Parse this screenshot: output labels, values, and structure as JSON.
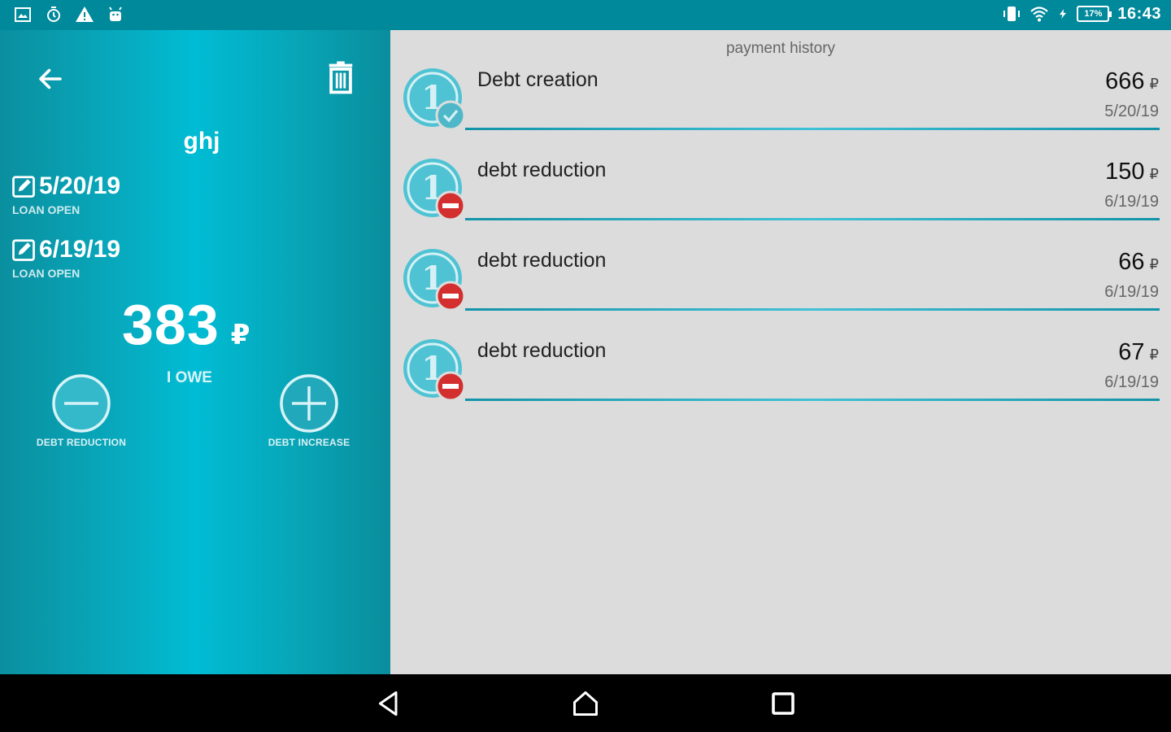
{
  "status_bar": {
    "left_icons": [
      "image-notification-icon",
      "alarm-notification-icon",
      "warning-icon",
      "android-icon"
    ],
    "right_icons": [
      "vibrate-icon",
      "wifi-icon",
      "charging-icon"
    ],
    "battery": "17%",
    "time": "16:43"
  },
  "detail": {
    "name": "ghj",
    "open_date": "5/20/19",
    "open_label": "LOAN OPEN",
    "close_date": "6/19/19",
    "close_label": "LOAN OPEN",
    "amount": "383",
    "currency": "₽",
    "direction_label": "I OWE",
    "reduce_label": "DEBT REDUCTION",
    "increase_label": "DEBT INCREASE"
  },
  "history": {
    "title": "payment history",
    "items": [
      {
        "title": "Debt creation",
        "amount": "666",
        "currency": "₽",
        "date": "5/20/19",
        "badge": "check-badge-icon"
      },
      {
        "title": "debt reduction",
        "amount": "150",
        "currency": "₽",
        "date": "6/19/19",
        "badge": "minus-badge-icon"
      },
      {
        "title": "debt reduction",
        "amount": "66",
        "currency": "₽",
        "date": "6/19/19",
        "badge": "minus-badge-icon"
      },
      {
        "title": "debt reduction",
        "amount": "67",
        "currency": "₽",
        "date": "6/19/19",
        "badge": "minus-badge-icon"
      }
    ]
  },
  "colors": {
    "status_bar": "#00899b",
    "accent": "#00bcd4",
    "panel_bg": "#dcdcdc",
    "check_badge": "#4fb8c8",
    "minus_badge": "#d32f2f"
  }
}
